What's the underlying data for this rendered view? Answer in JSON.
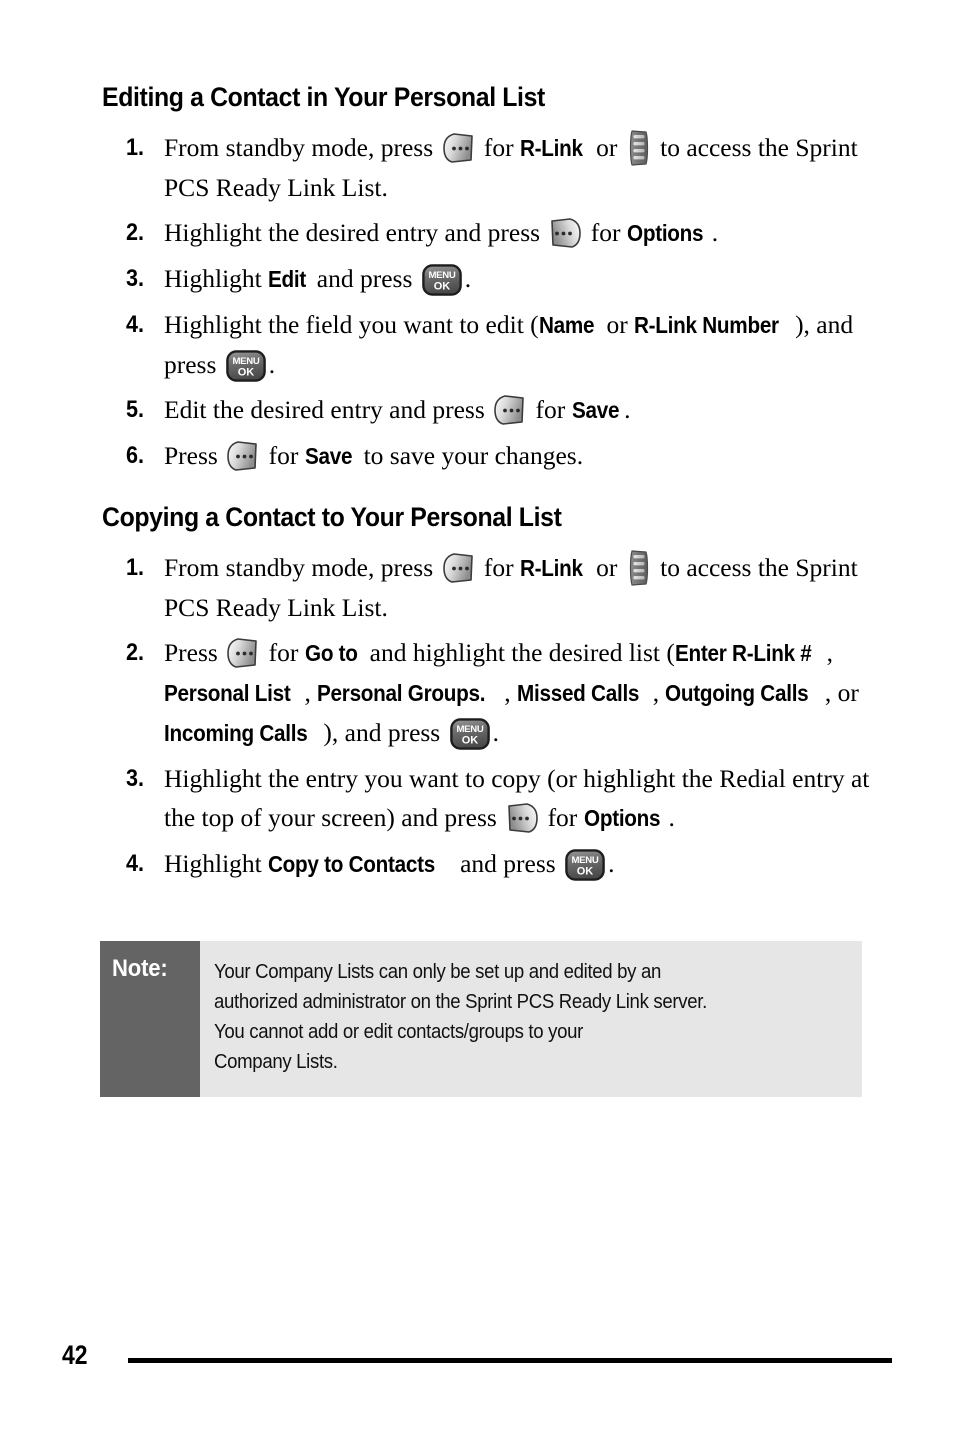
{
  "document": {
    "page_number": "42"
  },
  "sections": [
    {
      "heading": "Editing a Contact in Your Personal List",
      "steps": [
        {
          "number": "1.",
          "parts": [
            {
              "t": "text",
              "v": "From standby mode, press "
            },
            {
              "t": "key",
              "icon": "softkey-left-icon"
            },
            {
              "t": "text",
              "v": " for "
            },
            {
              "t": "ui",
              "v": "R-Link"
            },
            {
              "t": "text",
              "v": " or "
            },
            {
              "t": "key",
              "icon": "side-key-icon"
            },
            {
              "t": "text",
              "v": " to access the Sprint PCS Ready Link List."
            }
          ]
        },
        {
          "number": "2.",
          "parts": [
            {
              "t": "text",
              "v": "Highlight the desired entry and press "
            },
            {
              "t": "key",
              "icon": "softkey-right-icon"
            },
            {
              "t": "text",
              "v": " for "
            },
            {
              "t": "ui",
              "v": "Options"
            },
            {
              "t": "text",
              "v": "."
            }
          ]
        },
        {
          "number": "3.",
          "parts": [
            {
              "t": "text",
              "v": "Highlight "
            },
            {
              "t": "ui",
              "v": "Edit"
            },
            {
              "t": "text",
              "v": " and press "
            },
            {
              "t": "key",
              "icon": "menu-ok-key-icon"
            },
            {
              "t": "text",
              "v": "."
            }
          ]
        },
        {
          "number": "4.",
          "parts": [
            {
              "t": "text",
              "v": "Highlight the field you want to edit ("
            },
            {
              "t": "ui",
              "v": "Name"
            },
            {
              "t": "text",
              "v": " or "
            },
            {
              "t": "ui",
              "v": "R-Link Number"
            },
            {
              "t": "text",
              "v": "), and press "
            },
            {
              "t": "key",
              "icon": "menu-ok-key-icon"
            },
            {
              "t": "text",
              "v": "."
            }
          ]
        },
        {
          "number": "5.",
          "parts": [
            {
              "t": "text",
              "v": "Edit the desired entry and press "
            },
            {
              "t": "key",
              "icon": "softkey-left-icon"
            },
            {
              "t": "text",
              "v": " for "
            },
            {
              "t": "ui",
              "v": "Save"
            },
            {
              "t": "text",
              "v": "."
            }
          ]
        },
        {
          "number": "6.",
          "parts": [
            {
              "t": "text",
              "v": "Press "
            },
            {
              "t": "key",
              "icon": "softkey-left-icon"
            },
            {
              "t": "text",
              "v": " for "
            },
            {
              "t": "ui",
              "v": "Save"
            },
            {
              "t": "text",
              "v": " to save your changes."
            }
          ]
        }
      ]
    },
    {
      "heading": "Copying a Contact to Your Personal List",
      "steps": [
        {
          "number": "1.",
          "parts": [
            {
              "t": "text",
              "v": "From standby mode, press "
            },
            {
              "t": "key",
              "icon": "softkey-left-icon"
            },
            {
              "t": "text",
              "v": " for "
            },
            {
              "t": "ui",
              "v": "R-Link"
            },
            {
              "t": "text",
              "v": " or "
            },
            {
              "t": "key",
              "icon": "side-key-icon"
            },
            {
              "t": "text",
              "v": " to access the Sprint PCS Ready Link List."
            }
          ]
        },
        {
          "number": "2.",
          "parts": [
            {
              "t": "text",
              "v": "Press "
            },
            {
              "t": "key",
              "icon": "softkey-left-icon"
            },
            {
              "t": "text",
              "v": " for "
            },
            {
              "t": "ui",
              "v": "Go to"
            },
            {
              "t": "text",
              "v": " and highlight the desired list ("
            },
            {
              "t": "ui",
              "v": "Enter R-Link #"
            },
            {
              "t": "text",
              "v": ", "
            },
            {
              "t": "ui",
              "v": "Personal List"
            },
            {
              "t": "text",
              "v": ", "
            },
            {
              "t": "ui",
              "v": "Personal Groups."
            },
            {
              "t": "text",
              "v": ", "
            },
            {
              "t": "ui",
              "v": "Missed Calls"
            },
            {
              "t": "text",
              "v": ", "
            },
            {
              "t": "ui",
              "v": "Outgoing Calls"
            },
            {
              "t": "text",
              "v": ", or "
            },
            {
              "t": "ui",
              "v": "Incoming Calls"
            },
            {
              "t": "text",
              "v": "), and press "
            },
            {
              "t": "key",
              "icon": "menu-ok-key-icon"
            },
            {
              "t": "text",
              "v": "."
            }
          ]
        },
        {
          "number": "3.",
          "parts": [
            {
              "t": "text",
              "v": "Highlight the entry you want to copy (or highlight the Redial entry at the top of your screen) and press "
            },
            {
              "t": "key",
              "icon": "softkey-right-icon"
            },
            {
              "t": "text",
              "v": " for "
            },
            {
              "t": "ui",
              "v": "Options"
            },
            {
              "t": "text",
              "v": "."
            }
          ]
        },
        {
          "number": "4.",
          "parts": [
            {
              "t": "text",
              "v": "Highlight "
            },
            {
              "t": "ui",
              "v": "Copy to Contacts"
            },
            {
              "t": "text",
              "v": " and press "
            },
            {
              "t": "key",
              "icon": "menu-ok-key-icon"
            },
            {
              "t": "text",
              "v": "."
            }
          ]
        }
      ]
    }
  ],
  "note": {
    "label": "Note:",
    "lines": [
      "Your Company Lists can only be set up and edited by an",
      "authorized administrator on the Sprint PCS Ready Link server.",
      "You cannot add or edit contacts/groups to your",
      "Company Lists."
    ]
  },
  "key_icons": {
    "menu_ok_line1": "MENU",
    "menu_ok_line2": "OK"
  },
  "colors": {
    "note_label_bg": "#646464",
    "note_body_bg": "#e6e6e6",
    "text": "#000000",
    "rule": "#000000"
  }
}
